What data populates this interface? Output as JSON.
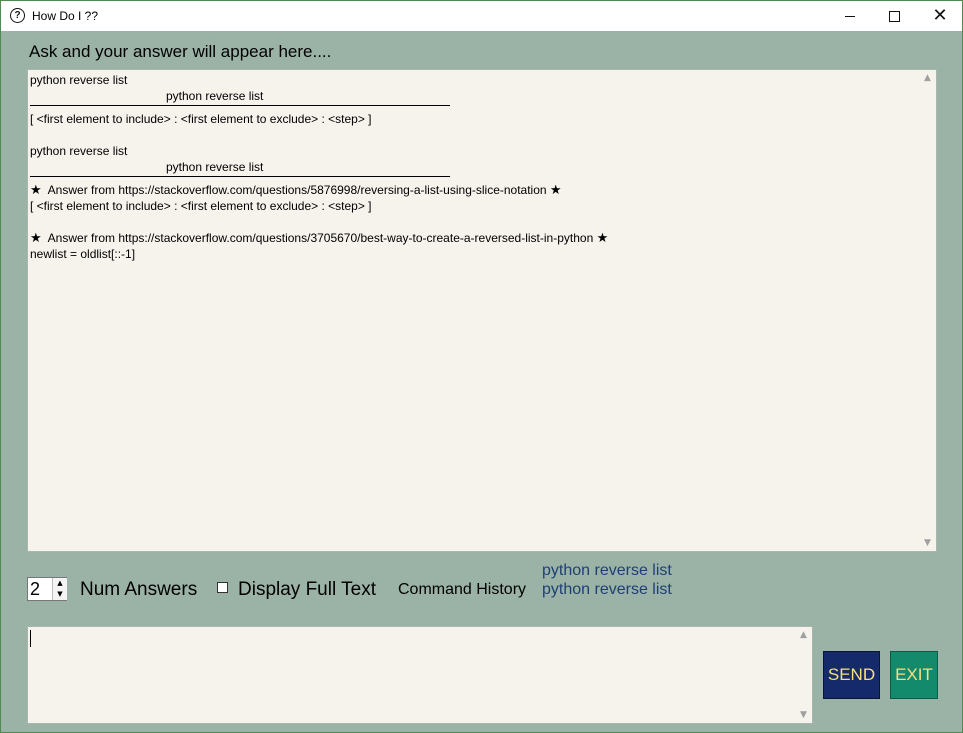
{
  "window": {
    "title": "How Do I ??",
    "icon": "question-circle-icon"
  },
  "prompt_label": "Ask and your answer will appear here....",
  "answer": {
    "blocks": [
      {
        "line1": "python reverse list",
        "line2": "python reverse list",
        "line3": "[ <first element to include> : <first element to exclude> : <step> ]"
      },
      {
        "line1": "python reverse list",
        "line2": "python reverse list"
      }
    ],
    "answers": [
      {
        "source": "Answer from https://stackoverflow.com/questions/5876998/reversing-a-list-using-slice-notation",
        "text": "[ <first element to include> : <first element to exclude> : <step> ]"
      },
      {
        "source": "Answer from https://stackoverflow.com/questions/3705670/best-way-to-create-a-reversed-list-in-python",
        "text": "newlist = oldlist[::-1]"
      }
    ],
    "star": "★"
  },
  "controls": {
    "num_answers_value": "2",
    "num_answers_label": "Num Answers",
    "display_full_text_label": "Display Full Text",
    "display_full_text_checked": false,
    "command_history_label": "Command History",
    "history": [
      "python reverse list",
      "python reverse list"
    ]
  },
  "input": {
    "value": ""
  },
  "buttons": {
    "send": "SEND",
    "exit": "EXIT"
  },
  "colors": {
    "background": "#9bb3a6",
    "text_area": "#f6f2ec",
    "send_bg": "#142a6b",
    "exit_bg": "#138a6c",
    "button_text": "#f7e07a",
    "history_text": "#1f3f74"
  }
}
